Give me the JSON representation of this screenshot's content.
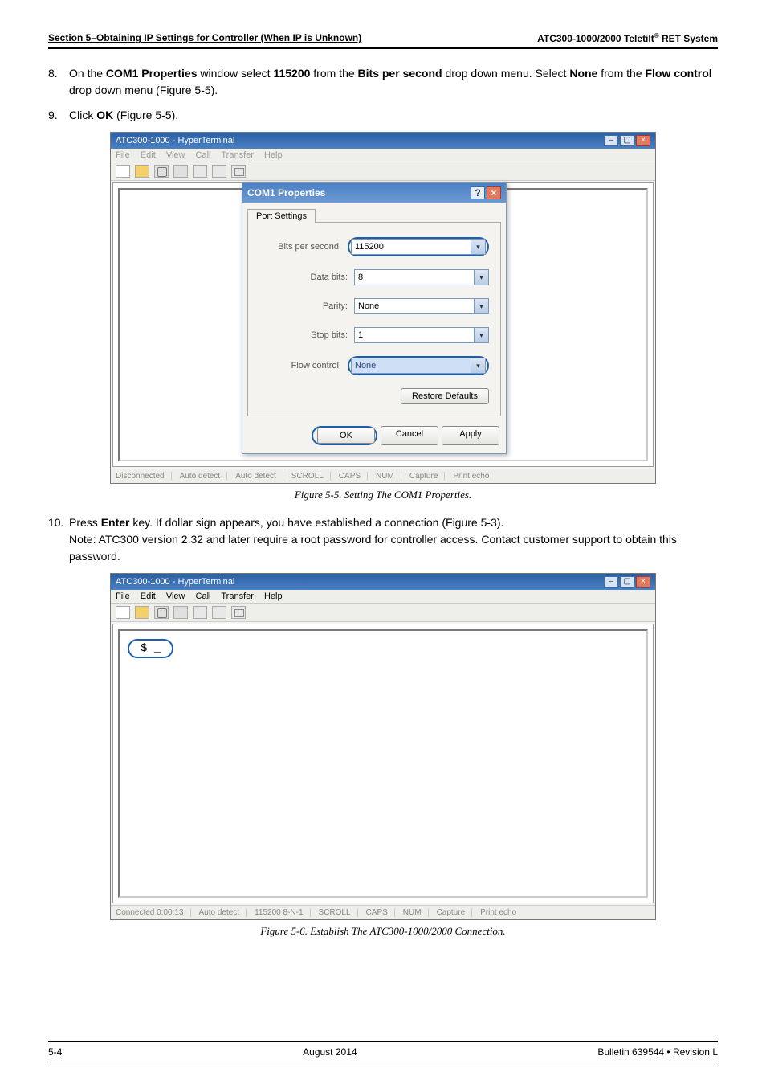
{
  "header": {
    "section": "Section 5–Obtaining IP Settings for Controller (When IP is Unknown)",
    "product_a": "ATC300-1000/2000 Teletilt",
    "product_sup": "®",
    "product_b": " RET System"
  },
  "steps": {
    "s8": {
      "num": "8.",
      "t1": "On the ",
      "b1": "COM1 Properties",
      "t2": " window select ",
      "b2": "115200",
      "t3": " from the ",
      "b3": "Bits per second",
      "t4": " drop down menu. Select ",
      "b4": "None",
      "t5": " from the ",
      "b5": "Flow control",
      "t6": " drop down menu (Figure 5-5)."
    },
    "s9": {
      "num": "9.",
      "t1": "Click ",
      "b1": "OK",
      "t2": " (Figure 5-5)."
    },
    "s10": {
      "num": "10.",
      "t1": "Press ",
      "b1": "Enter",
      "t2": " key. If dollar sign appears, you have established a connection (Figure 5-3).",
      "note": "Note: ATC300 version 2.32 and later require a root password for controller access. Contact customer support to obtain this password."
    }
  },
  "captions": {
    "fig55": "Figure 5-5.  Setting The COM1 Properties.",
    "fig56": "Figure 5-6.  Establish The ATC300-1000/2000 Connection."
  },
  "fig1": {
    "window_title": "ATC300-1000 - HyperTerminal",
    "menu": {
      "file": "File",
      "edit": "Edit",
      "view": "View",
      "call": "Call",
      "transfer": "Transfer",
      "help": "Help"
    },
    "dlg_title": "COM1 Properties",
    "tab": "Port Settings",
    "rows": {
      "bps": {
        "label": "Bits per second:",
        "value": "115200"
      },
      "databits": {
        "label": "Data bits:",
        "value": "8"
      },
      "parity": {
        "label": "Parity:",
        "value": "None"
      },
      "stopbits": {
        "label": "Stop bits:",
        "value": "1"
      },
      "flow": {
        "label": "Flow control:",
        "value": "None"
      }
    },
    "buttons": {
      "restore": "Restore Defaults",
      "ok": "OK",
      "cancel": "Cancel",
      "apply": "Apply"
    },
    "status": {
      "conn": "Disconnected",
      "det1": "Auto detect",
      "det2": "Auto detect",
      "scroll": "SCROLL",
      "caps": "CAPS",
      "num": "NUM",
      "capture": "Capture",
      "print": "Print echo"
    }
  },
  "fig2": {
    "window_title": "ATC300-1000 - HyperTerminal",
    "menu": {
      "file": "File",
      "edit": "Edit",
      "view": "View",
      "call": "Call",
      "transfer": "Transfer",
      "help": "Help"
    },
    "prompt": "$ _",
    "status": {
      "conn": "Connected 0:00:13",
      "det": "Auto detect",
      "cfg": "115200 8-N-1",
      "scroll": "SCROLL",
      "caps": "CAPS",
      "num": "NUM",
      "capture": "Capture",
      "print": "Print echo"
    }
  },
  "footer": {
    "left": "5-4",
    "center": "August 2014",
    "right": "Bulletin 639544  •  Revision L"
  }
}
